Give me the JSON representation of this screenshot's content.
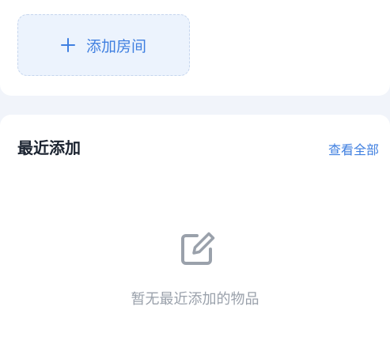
{
  "rooms": {
    "add_room_label": "添加房间"
  },
  "recent": {
    "title": "最近添加",
    "view_all_label": "查看全部",
    "empty_message": "暂无最近添加的物品"
  },
  "icons": {
    "add": "plus-icon",
    "empty": "edit-note-icon"
  },
  "colors": {
    "accent": "#3f7fe0",
    "background": "#f1f4fa",
    "muted_text": "#9aa1ab"
  }
}
